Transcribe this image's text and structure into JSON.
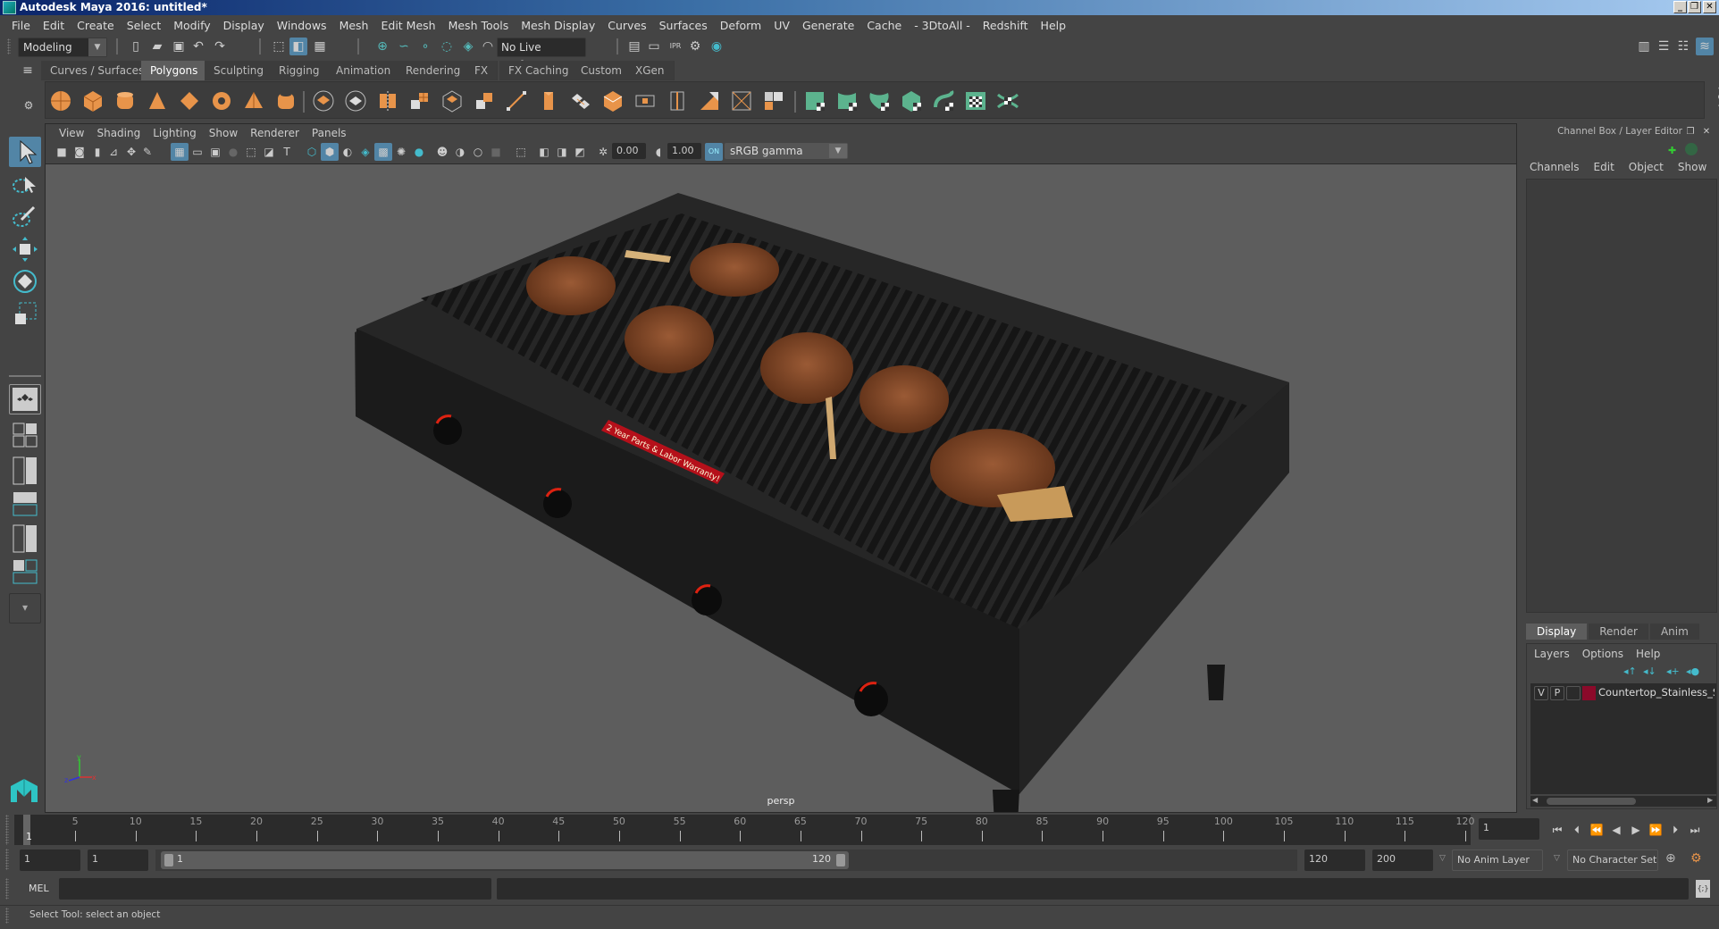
{
  "window": {
    "title": "Autodesk Maya 2016: untitled*",
    "controls": [
      "minimize",
      "restore",
      "close"
    ]
  },
  "menubar": [
    "File",
    "Edit",
    "Create",
    "Select",
    "Modify",
    "Display",
    "Windows",
    "Mesh",
    "Edit Mesh",
    "Mesh Tools",
    "Mesh Display",
    "Curves",
    "Surfaces",
    "Deform",
    "UV",
    "Generate",
    "Cache",
    "- 3DtoAll -",
    "Redshift",
    "Help"
  ],
  "statusline": {
    "menuset": "Modeling",
    "live_surface": "No Live Surface"
  },
  "shelf": {
    "tabs": [
      "Curves / Surfaces",
      "Polygons",
      "Sculpting",
      "Rigging",
      "Animation",
      "Rendering",
      "FX",
      "FX Caching",
      "Custom",
      "XGen"
    ],
    "active_tab": "Polygons"
  },
  "viewport": {
    "menu": [
      "View",
      "Shading",
      "Lighting",
      "Show",
      "Renderer",
      "Panels"
    ],
    "exposure": "0.00",
    "gamma": "1.00",
    "color_space": "sRGB gamma",
    "camera_label": "persp",
    "scene_decal_text": "2 Year Parts & Labor Warranty!"
  },
  "channel_box": {
    "title": "Channel Box / Layer Editor",
    "menu": [
      "Channels",
      "Edit",
      "Object",
      "Show"
    ]
  },
  "layer_editor": {
    "tabs": [
      "Display",
      "Render",
      "Anim"
    ],
    "active_tab": "Display",
    "menu": [
      "Layers",
      "Options",
      "Help"
    ],
    "layers": [
      {
        "visible": "V",
        "playback": "P",
        "name": "Countertop_Stainless_S",
        "color": "#8b0a2a"
      }
    ]
  },
  "timeline": {
    "ticks": [
      5,
      10,
      15,
      20,
      25,
      30,
      35,
      40,
      45,
      50,
      55,
      60,
      65,
      70,
      75,
      80,
      85,
      90,
      95,
      100,
      105,
      110,
      115,
      120
    ],
    "range_start": 1,
    "range_end": 120,
    "current_frame_marker": "1",
    "current_frame": "1"
  },
  "range": {
    "start_field": "1",
    "playback_start": "1",
    "slider_start": "1",
    "slider_end": "120",
    "playback_end": "120",
    "end_field": "200",
    "anim_layer": "No Anim Layer",
    "character_set": "No Character Set"
  },
  "command_line": {
    "label": "MEL"
  },
  "help_line": "Select Tool: select an object"
}
